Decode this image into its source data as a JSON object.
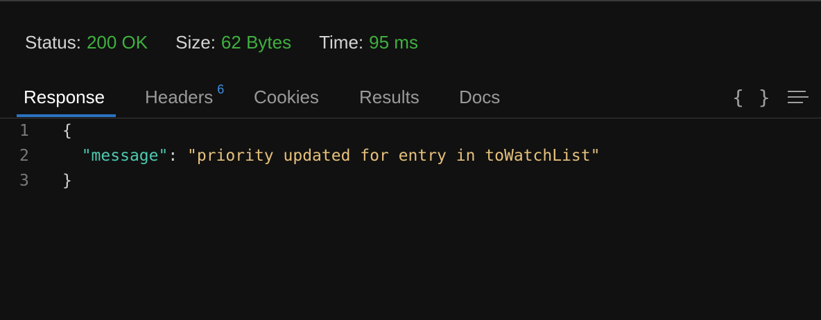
{
  "status_bar": {
    "status_label": "Status:",
    "status_value": "200 OK",
    "size_label": "Size:",
    "size_value": "62 Bytes",
    "time_label": "Time:",
    "time_value": "95 ms"
  },
  "tabs": [
    {
      "label": "Response",
      "active": true
    },
    {
      "label": "Headers",
      "badge": "6"
    },
    {
      "label": "Cookies"
    },
    {
      "label": "Results"
    },
    {
      "label": "Docs"
    }
  ],
  "toolbar": {
    "format_icon": "braces-icon",
    "wrap_icon": "wrap-lines-icon",
    "format_glyph": "{ }"
  },
  "editor": {
    "line_numbers": [
      "1",
      "2",
      "3"
    ],
    "line1": "{",
    "line2_indent": "  ",
    "line2_key": "\"message\"",
    "line2_colon": ": ",
    "line2_value": "\"priority updated for entry in toWatchList\"",
    "line3": "}"
  },
  "colors": {
    "background": "#111111",
    "status_ok": "#3fb040",
    "accent": "#2b73c2",
    "badge": "#3d8fe0",
    "json_key": "#4ec9b0",
    "json_string": "#e5c07b"
  }
}
